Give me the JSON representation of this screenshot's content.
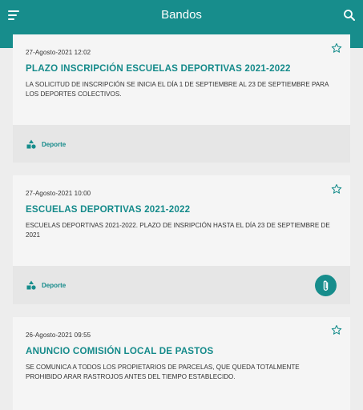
{
  "header": {
    "title": "Bandos"
  },
  "colors": {
    "primary": "#178d8c",
    "accent_text": "#148a8a",
    "background": "#ededed",
    "card": "#f5f5f5",
    "card_footer": "#e6e6e6"
  },
  "posts": [
    {
      "date": "27-Agosto-2021 12:02",
      "title": "PLAZO INSCRIPCIÓN ESCUELAS DEPORTIVAS 2021-2022",
      "body": "LA SOLICITUD DE INSCRIPCIÓN SE INICIA EL DÍA 1 DE SEPTIEMBRE AL 23 DE SEPTIEMBRE PARA LOS DEPORTES COLECTIVOS.",
      "category": "Deporte",
      "has_attachment": false,
      "icons": {
        "favorite": "star-outline-icon",
        "category": "shapes-icon"
      }
    },
    {
      "date": "27-Agosto-2021 10:00",
      "title": "ESCUELAS DEPORTIVAS 2021-2022",
      "body": "ESCUELAS DEPORTIVAS 2021-2022. PLAZO DE INSRIPCIÓN HASTA EL DÍA 23 DE SEPTIEMBRE DE 2021",
      "category": "Deporte",
      "has_attachment": true,
      "icons": {
        "favorite": "star-outline-icon",
        "category": "shapes-icon",
        "attachment": "paperclip-icon"
      }
    },
    {
      "date": "26-Agosto-2021 09:55",
      "title": "ANUNCIO COMISIÓN LOCAL DE PASTOS",
      "body": "SE COMUNICA A TODOS LOS PROPIETARIOS DE PARCELAS, QUE QUEDA TOTALMENTE PROHIBIDO ARAR RASTROJOS ANTES DEL TIEMPO ESTABLECIDO.",
      "icons": {
        "favorite": "star-outline-icon"
      }
    }
  ]
}
